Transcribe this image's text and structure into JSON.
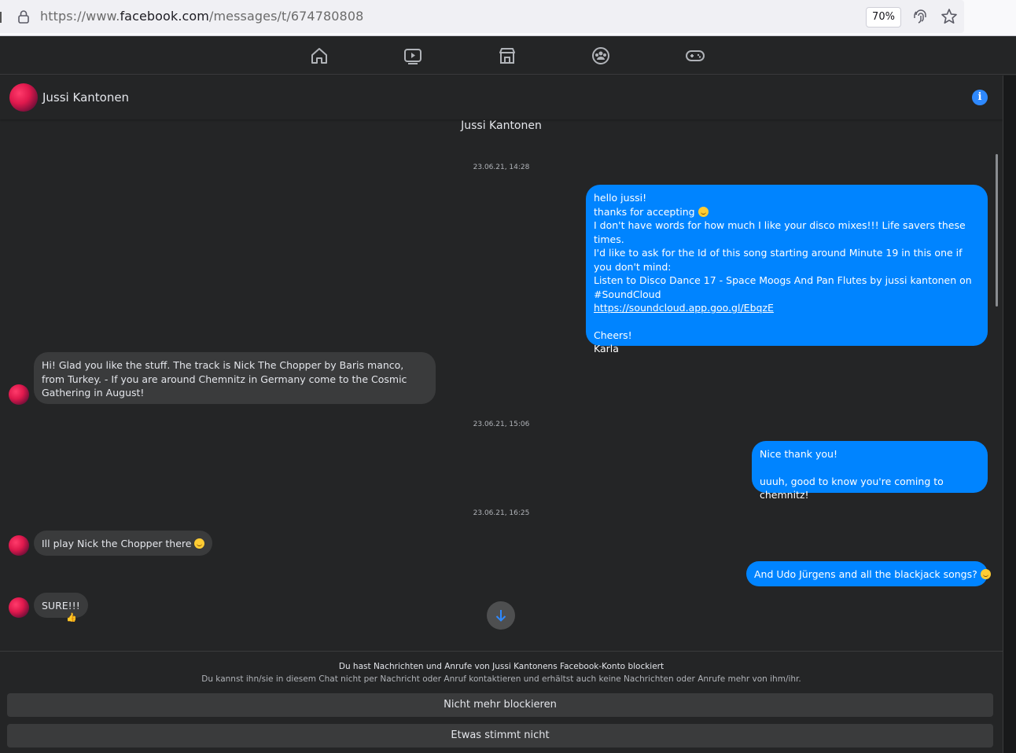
{
  "browser": {
    "url_prefix": "https://www.",
    "url_domain": "facebook.com",
    "url_path": "/messages/t/674780808",
    "zoom": "70%"
  },
  "nav": {
    "icons": [
      "home-icon",
      "watch-icon",
      "marketplace-icon",
      "groups-icon",
      "gaming-icon"
    ]
  },
  "header": {
    "contact_name": "Jussi Kantonen"
  },
  "chat": {
    "title": "Jussi Kantonen",
    "timestamps": [
      "23.06.21, 14:28",
      "23.06.21, 15:06",
      "23.06.21, 16:25"
    ],
    "msg1": {
      "line1": "hello jussi!",
      "line2": "thanks for accepting",
      "line3": "I don't have words for how much I like your disco mixes!!! Life savers these times.",
      "line4": "I'd like to ask for the Id of this song starting around Minute 19 in this one if you don't mind:",
      "line5": "Listen to Disco Dance 17 - Space Moogs And Pan Flutes by jussi kantonen on #SoundCloud",
      "link": "https://soundcloud.app.goo.gl/EbqzE",
      "line6": "Cheers!",
      "line7": "Karla"
    },
    "msg2": "Hi! Glad you like the stuff. The track is Nick The Chopper by Baris manco, from Turkey. - If you are around Chemnitz in Germany come to the Cosmic Gathering in August!",
    "msg3": {
      "line1": "Nice thank you!",
      "line2": "uuuh, good to know you're coming to chemnitz!"
    },
    "msg4": "Ill play Nick the Chopper there",
    "msg5": "And Udo Jürgens and all the blackjack songs?",
    "msg6": "SURE!!!",
    "reaction": "👍"
  },
  "blocked": {
    "title": "Du hast Nachrichten und Anrufe von Jussi Kantonens Facebook-Konto blockiert",
    "subtitle": "Du kannst ihn/sie in diesem Chat nicht per Nachricht oder Anruf kontaktieren und erhältst auch keine Nachrichten oder Anrufe mehr von ihm/ihr.",
    "unblock_label": "Nicht mehr blockieren",
    "report_label": "Etwas stimmt nicht"
  },
  "colors": {
    "outgoing": "#0084ff",
    "incoming": "#3a3b3c",
    "background": "#242526"
  }
}
